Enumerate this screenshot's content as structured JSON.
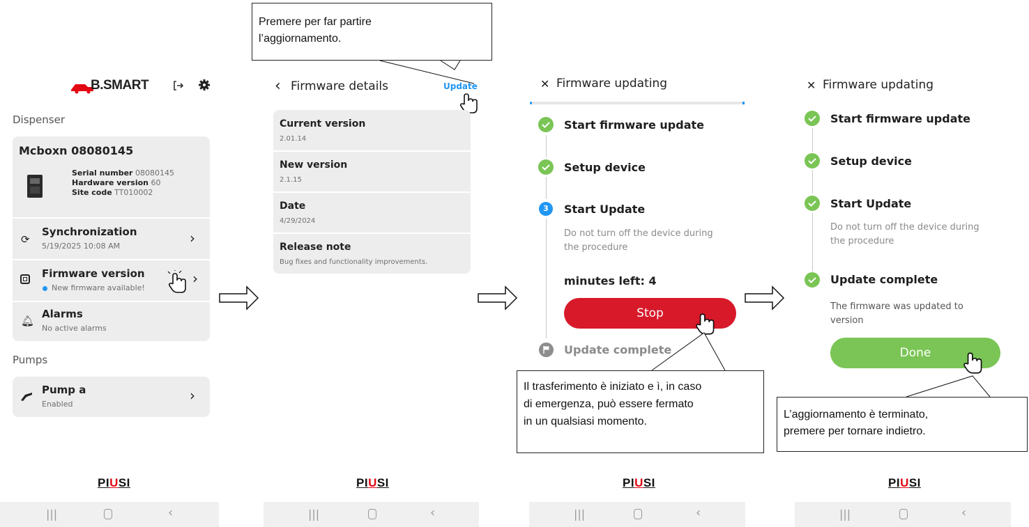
{
  "screen1": {
    "logo": "B.SMART",
    "dispenser_heading": "Dispenser",
    "device_name": "Mcboxn 08080145",
    "serial_label": "Serial number",
    "serial_value": "08080145",
    "hw_label": "Hardware version",
    "hw_value": "60",
    "site_label": "Site code",
    "site_value": "TT010002",
    "sync_title": "Synchronization",
    "sync_sub": "5/19/2025 10:08 AM",
    "fw_title": "Firmware version",
    "fw_sub": "New firmware available!",
    "alarms_title": "Alarms",
    "alarms_sub": "No active alarms",
    "pumps_heading": "Pumps",
    "pump_title": "Pump a",
    "pump_sub": "Enabled"
  },
  "screen2": {
    "title": "Firmware details",
    "update_link": "Update",
    "rows": [
      {
        "label": "Current version",
        "value": "2.01.14"
      },
      {
        "label": "New version",
        "value": "2.1.15"
      },
      {
        "label": "Date",
        "value": "4/29/2024"
      },
      {
        "label": "Release note",
        "value": "Bug fixes and functionality improvements."
      }
    ]
  },
  "screen3": {
    "title": "Firmware updating",
    "step1": "Start firmware update",
    "step2": "Setup device",
    "step3_num": "3",
    "step3": "Start Update",
    "step3_desc_1": "Do not turn off the device during",
    "step3_desc_2": "the procedure",
    "minutes_left": "minutes left: 4",
    "stop_button": "Stop",
    "step4": "Update complete"
  },
  "screen4": {
    "title": "Firmware updating",
    "step1": "Start firmware update",
    "step2": "Setup device",
    "step3": "Start Update",
    "step3_desc_1": "Do not turn off the device during",
    "step3_desc_2": "the procedure",
    "step4": "Update complete",
    "step4_desc_1": "The firmware was updated to",
    "step4_desc_2": "version",
    "done_button": "Done"
  },
  "brand": {
    "piusi_a": "PI",
    "piusi_b": "U",
    "piusi_c": "SI"
  },
  "callouts": {
    "top_1": "Premere per far partire",
    "top_2": "l’aggiornamento.",
    "mid_1": "Il trasferimento è iniziato e ì, in caso",
    "mid_2": "di emergenza, può essere fermato",
    "mid_3": "in un qualsiasi momento.",
    "right_1": "L’aggiornamento è terminato,",
    "right_2": "premere per tornare indietro."
  },
  "colors": {
    "accent_blue": "#2196f3",
    "green": "#7ac555",
    "red": "#d7192a",
    "card": "#ededed"
  }
}
